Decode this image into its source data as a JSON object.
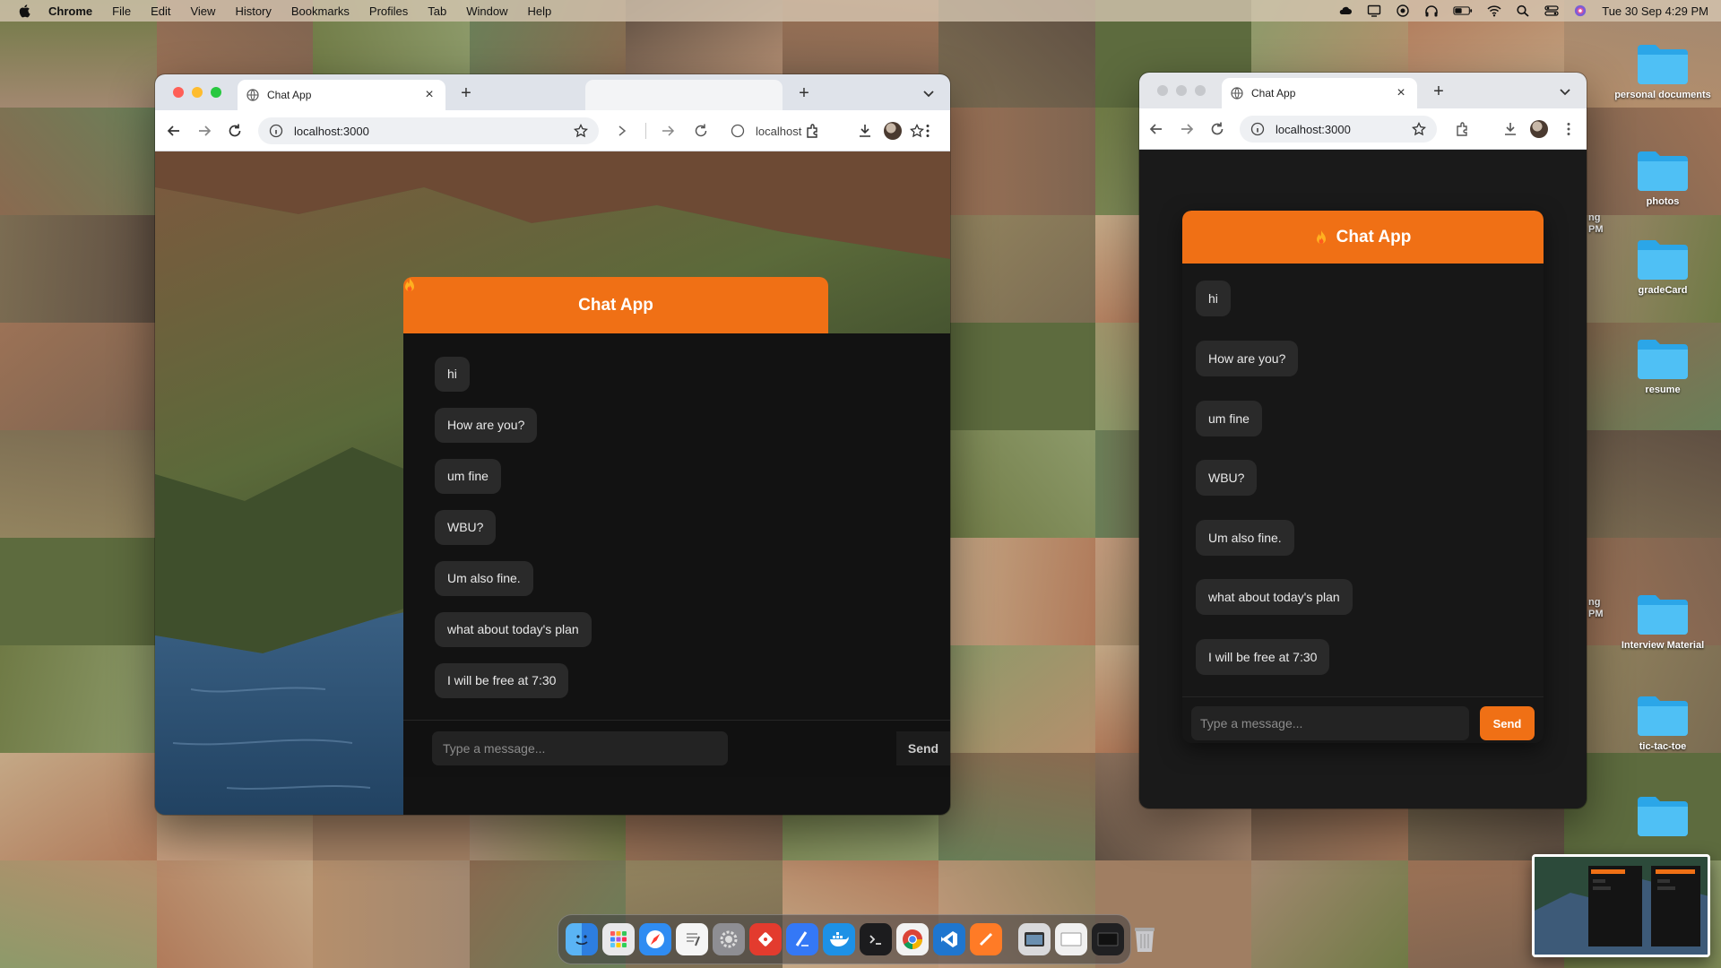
{
  "menubar": {
    "app_name": "Chrome",
    "items": [
      "File",
      "Edit",
      "View",
      "History",
      "Bookmarks",
      "Profiles",
      "Tab",
      "Window",
      "Help"
    ],
    "clock": "Tue 30 Sep  4:29 PM",
    "status_icons": [
      "cloud-icon",
      "screen-mirror-icon",
      "record-icon",
      "headphones-icon",
      "battery-icon",
      "wifi-icon",
      "search-icon",
      "control-center-icon",
      "siri-icon"
    ]
  },
  "window_left": {
    "tab_title": "Chat App",
    "url": "localhost:3000",
    "ghost_url": "localhost",
    "chat": {
      "title": "Chat App",
      "messages": [
        "hi",
        "How are you?",
        "um fine",
        "WBU?",
        "Um also fine.",
        "what about today's plan",
        "I will be free at 7:30"
      ],
      "input_placeholder": "Type a message...",
      "send_label": "Send"
    }
  },
  "window_right": {
    "tab_title": "Chat App",
    "url": "localhost:3000",
    "chat": {
      "title": "Chat App",
      "messages": [
        "hi",
        "How are you?",
        "um fine",
        "WBU?",
        "Um also fine.",
        "what about today's plan",
        "I will be free at 7:30"
      ],
      "input_placeholder": "Type a message...",
      "send_label": "Send"
    }
  },
  "desktop": {
    "folders": [
      "personal documents",
      "photos",
      "gradeCard",
      "resume",
      "Interview Material",
      "tic-tac-toe",
      ""
    ],
    "partial_labels": [
      "ng\nPM",
      "ng\nPM"
    ]
  },
  "dock": {
    "apps": [
      "finder-icon",
      "launchpad-icon",
      "safari-icon",
      "textedit-icon",
      "system-settings-icon",
      "git-icon",
      "xcode-icon",
      "docker-icon",
      "terminal-icon",
      "chrome-icon",
      "vscode-icon",
      "sublime-icon"
    ],
    "recents": [
      "preview-icon",
      "window-icon",
      "terminal-window-icon"
    ],
    "trash": "trash-icon"
  },
  "colors": {
    "accent": "#f07015",
    "chat_bg": "#121212",
    "bubble": "#2a2a2a"
  }
}
